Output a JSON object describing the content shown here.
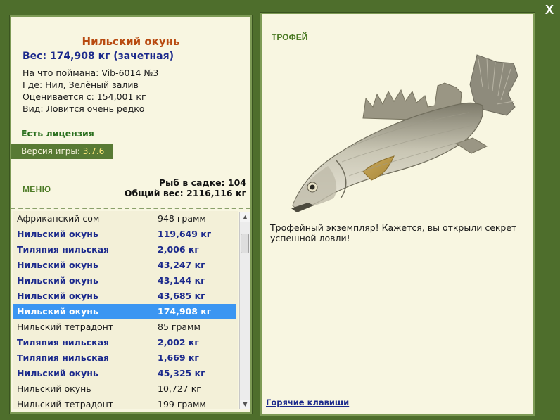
{
  "window": {
    "close_label": "X"
  },
  "details": {
    "fish_name": "Нильский окунь",
    "weight": "Вес: 174,908 кг (зачетная)",
    "bait": "На что поймана: Vib-6014 №3",
    "location": "Где: Нил, Зелёный залив",
    "valued_from": "Оценивается с: 154,001 кг",
    "rarity": "Вид: Ловится очень редко"
  },
  "license": "Есть лицензия",
  "version": {
    "label": "Версия игры:",
    "number": "3.7.6"
  },
  "menu_label": "МЕНЮ",
  "stats": {
    "fish_in_net": "Рыб в садке: 104",
    "total_weight": "Общий вес: 2116,116 кг"
  },
  "catch_list": [
    {
      "name": "Африканский сом",
      "weight": "948 грамм",
      "style": "plain"
    },
    {
      "name": "Нильский окунь",
      "weight": "119,649 кг",
      "style": "bold"
    },
    {
      "name": "Тиляпия нильская",
      "weight": "2,006 кг",
      "style": "bold"
    },
    {
      "name": "Нильский окунь",
      "weight": "43,247 кг",
      "style": "bold"
    },
    {
      "name": "Нильский окунь",
      "weight": "43,144 кг",
      "style": "bold"
    },
    {
      "name": "Нильский окунь",
      "weight": "43,685 кг",
      "style": "bold"
    },
    {
      "name": "Нильский окунь",
      "weight": "174,908 кг",
      "style": "sel"
    },
    {
      "name": "Нильский тетрадонт",
      "weight": "85 грамм",
      "style": "plain"
    },
    {
      "name": "Тиляпия нильская",
      "weight": "2,002 кг",
      "style": "bold"
    },
    {
      "name": "Тиляпия нильская",
      "weight": "1,669 кг",
      "style": "bold"
    },
    {
      "name": "Нильский окунь",
      "weight": "45,325 кг",
      "style": "bold"
    },
    {
      "name": "Нильский окунь",
      "weight": "10,727 кг",
      "style": "plain"
    },
    {
      "name": "Нильский тетрадонт",
      "weight": "199 грамм",
      "style": "plain"
    }
  ],
  "trophy": {
    "title": "ТРОФЕЙ",
    "text": "Трофейный экземпляр! Кажется, вы открыли секрет успешной ловли!"
  },
  "hotkeys_label": "Горячие клавиши",
  "colors": {
    "background": "#4e6e2c",
    "panel": "#f8f6e1",
    "selected_row": "#3b96f2",
    "fish_name": "#b84a10",
    "bold_text": "#1c2a8c",
    "green_label": "#4b7a24"
  }
}
